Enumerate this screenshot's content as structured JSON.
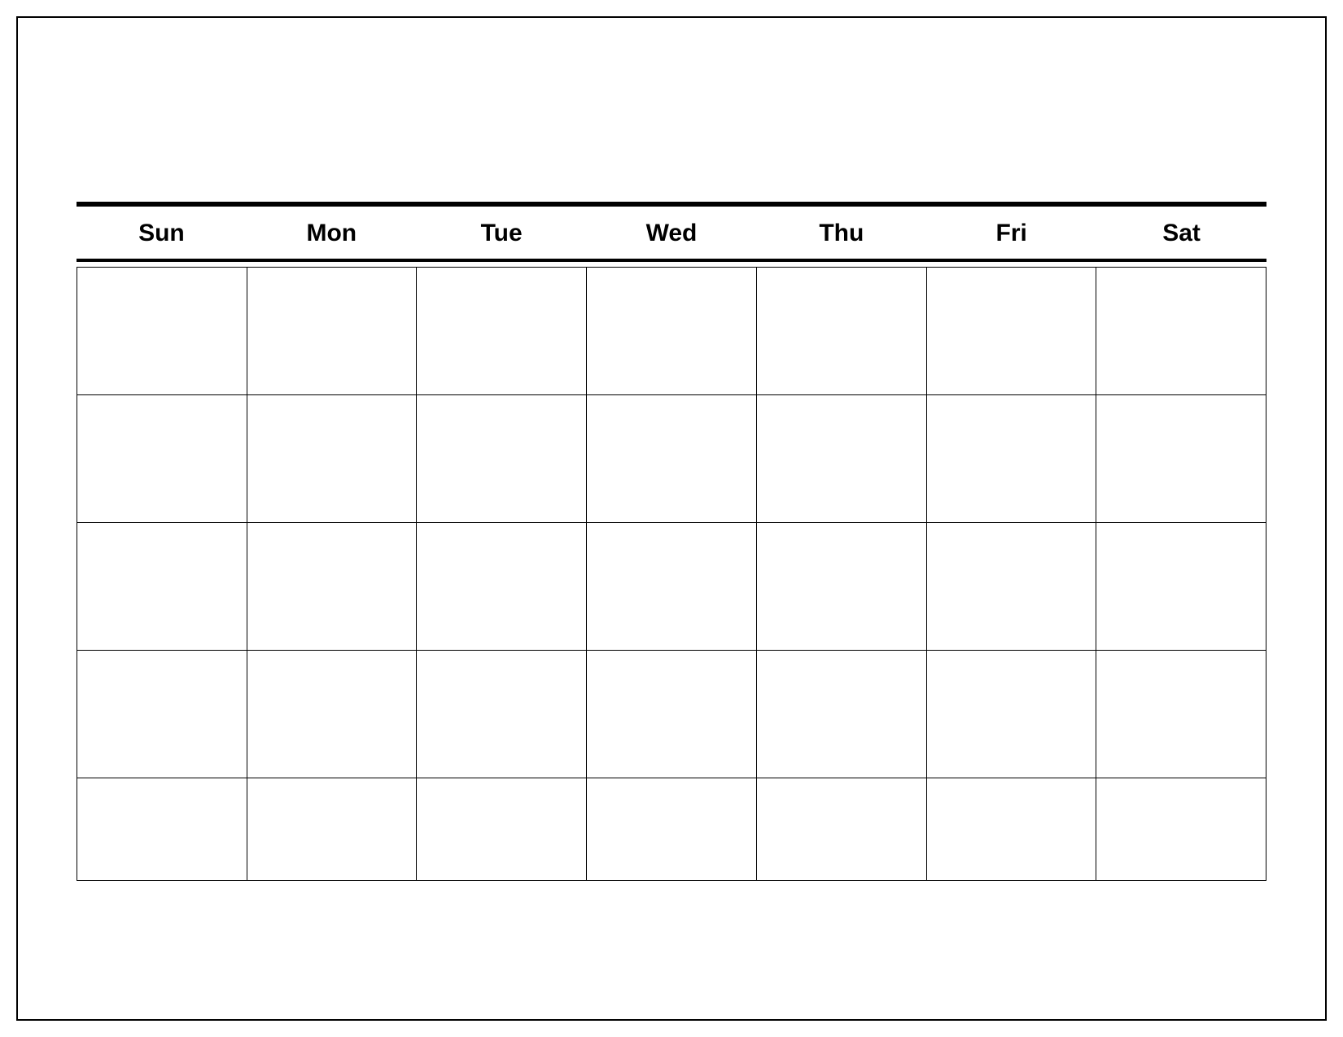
{
  "calendar": {
    "day_headers": [
      "Sun",
      "Mon",
      "Tue",
      "Wed",
      "Thu",
      "Fri",
      "Sat"
    ],
    "rows": 5,
    "columns": 7
  }
}
